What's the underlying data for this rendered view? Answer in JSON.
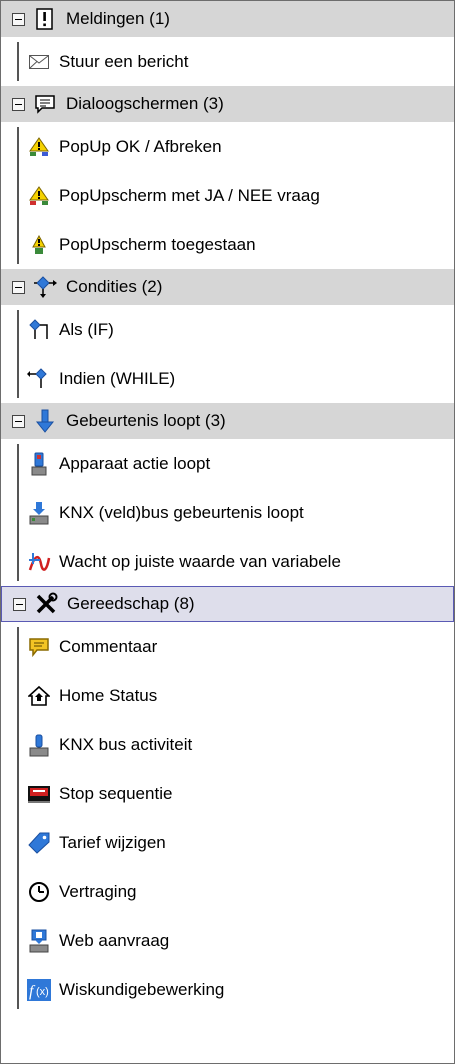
{
  "groups": [
    {
      "label": "Meldingen (1)",
      "icon": "exclamation-icon",
      "items": [
        {
          "label": "Stuur een bericht",
          "icon": "envelope-icon"
        }
      ]
    },
    {
      "label": "Dialoogschermen (3)",
      "icon": "chat-bubble-icon",
      "items": [
        {
          "label": "PopUp OK / Afbreken",
          "icon": "warning-ok-cancel-icon"
        },
        {
          "label": "PopUpscherm met JA / NEE vraag",
          "icon": "warning-yes-no-icon"
        },
        {
          "label": "PopUpscherm toegestaan",
          "icon": "warning-allowed-icon"
        }
      ]
    },
    {
      "label": "Condities (2)",
      "icon": "condition-diamond-icon",
      "items": [
        {
          "label": "Als (IF)",
          "icon": "if-branch-icon"
        },
        {
          "label": "Indien (WHILE)",
          "icon": "while-loop-icon"
        }
      ]
    },
    {
      "label": "Gebeurtenis loopt (3)",
      "icon": "arrow-down-icon",
      "items": [
        {
          "label": "Apparaat actie loopt",
          "icon": "device-action-icon"
        },
        {
          "label": "KNX (veld)bus gebeurtenis loopt",
          "icon": "knx-bus-event-icon"
        },
        {
          "label": "Wacht op juiste waarde van variabele",
          "icon": "wait-variable-icon"
        }
      ]
    },
    {
      "label": "Gereedschap (8)",
      "icon": "tools-icon",
      "selected": true,
      "items": [
        {
          "label": "Commentaar",
          "icon": "comment-icon"
        },
        {
          "label": "Home Status",
          "icon": "home-status-icon"
        },
        {
          "label": "KNX bus activiteit",
          "icon": "knx-activity-icon"
        },
        {
          "label": "Stop sequentie",
          "icon": "stop-sequence-icon"
        },
        {
          "label": "Tarief wijzigen",
          "icon": "tariff-tag-icon"
        },
        {
          "label": "Vertraging",
          "icon": "clock-icon"
        },
        {
          "label": "Web aanvraag",
          "icon": "web-request-icon"
        },
        {
          "label": "Wiskundigebewerking",
          "icon": "math-function-icon"
        }
      ]
    }
  ],
  "colors": {
    "group_header_bg": "#d6d6d6",
    "selected_header_bg": "#dedeeb",
    "selected_border": "#5a5ab4",
    "accent_blue": "#2f78d8"
  }
}
